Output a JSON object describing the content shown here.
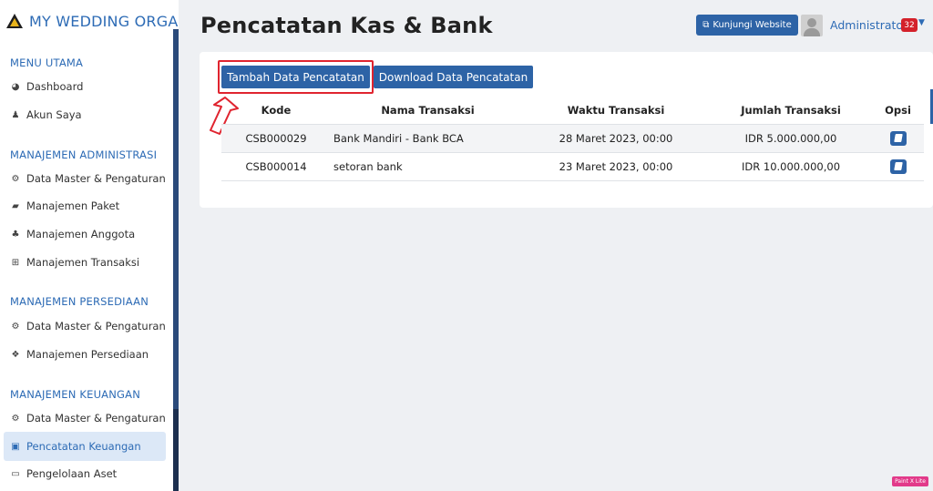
{
  "brand": {
    "name": "MY WEDDING ORGANI",
    "logo_icon": "triangle-logo-icon"
  },
  "sidebar": {
    "sections": [
      {
        "title": "MENU UTAMA",
        "items": [
          {
            "label": "Dashboard",
            "icon": "palette-icon"
          },
          {
            "label": "Akun Saya",
            "icon": "user-icon"
          }
        ]
      },
      {
        "title": "MANAJEMEN ADMINISTRASI",
        "items": [
          {
            "label": "Data Master & Pengaturan",
            "icon": "cogs-icon"
          },
          {
            "label": "Manajemen Paket",
            "icon": "book-icon"
          },
          {
            "label": "Manajemen Anggota",
            "icon": "users-icon"
          },
          {
            "label": "Manajemen Transaksi",
            "icon": "cart-icon"
          }
        ]
      },
      {
        "title": "MANAJEMEN PERSEDIAAN",
        "items": [
          {
            "label": "Data Master & Pengaturan",
            "icon": "cogs-icon"
          },
          {
            "label": "Manajemen Persediaan",
            "icon": "cubes-icon"
          }
        ]
      },
      {
        "title": "MANAJEMEN KEUANGAN",
        "items": [
          {
            "label": "Data Master & Pengaturan",
            "icon": "cogs-icon"
          },
          {
            "label": "Pencatatan Keuangan",
            "icon": "money-icon",
            "active": true
          },
          {
            "label": "Pengelolaan Aset",
            "icon": "hdd-icon"
          }
        ]
      }
    ]
  },
  "header": {
    "title": "Pencatatan Kas & Bank",
    "visit_label": "Kunjungi Website",
    "user_name": "Administrator",
    "badge_count": "32"
  },
  "actions": {
    "add_label": "Tambah Data Pencatatan",
    "download_label": "Download Data Pencatatan"
  },
  "table": {
    "columns": [
      "Kode",
      "Nama Transaksi",
      "Waktu Transaksi",
      "Jumlah Transaksi",
      "Opsi"
    ],
    "rows": [
      {
        "kode": "CSB000029",
        "nama": "Bank Mandiri - Bank BCA",
        "waktu": "28 Maret 2023, 00:00",
        "jumlah": "IDR 5.000.000,00"
      },
      {
        "kode": "CSB000014",
        "nama": "setoran bank",
        "waktu": "23 Maret 2023, 00:00",
        "jumlah": "IDR 10.000.000,00"
      }
    ]
  },
  "watermark": "Paint X Lite",
  "colors": {
    "primary": "#2d63a6",
    "accent_text": "#2d6bb5",
    "highlight": "#e0242f",
    "badge": "#d4212a"
  }
}
